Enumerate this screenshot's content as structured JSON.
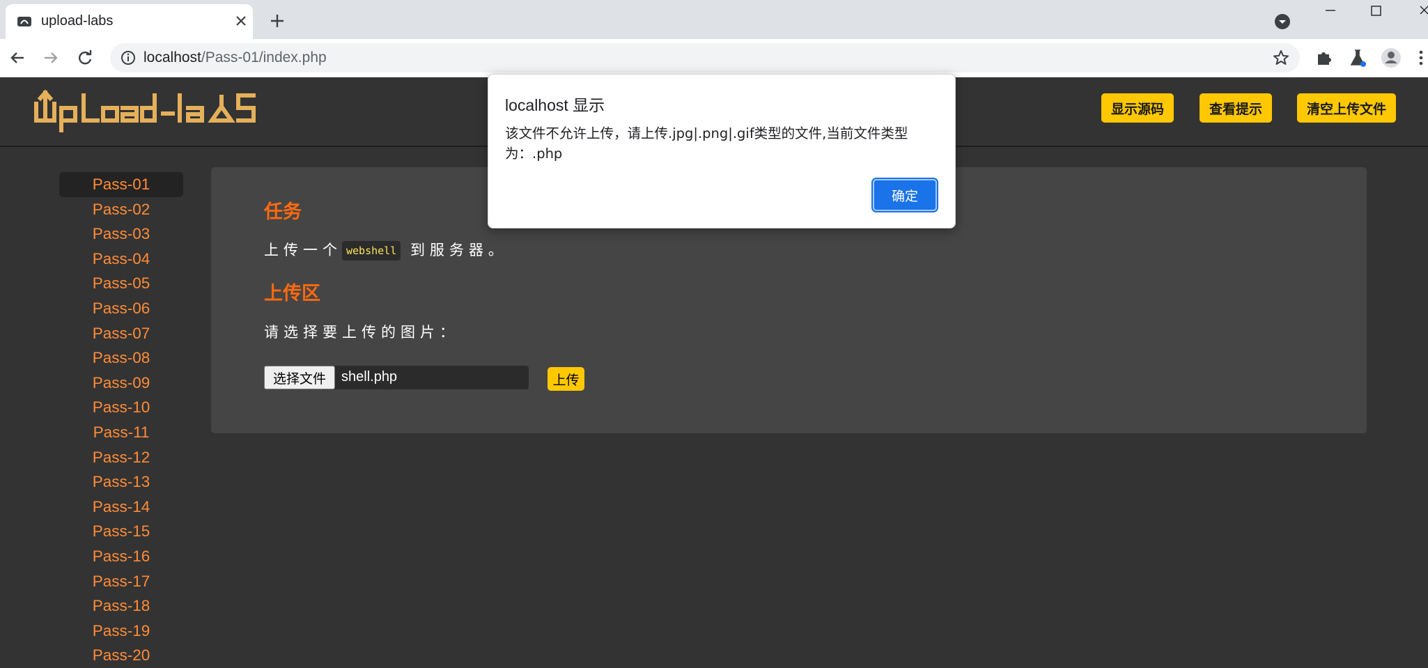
{
  "browser": {
    "tab_title": "upload-labs",
    "url_host": "localhost",
    "url_path": "/Pass-01/index.php"
  },
  "header": {
    "logo_text": "UpLoad-labs",
    "buttons": [
      "显示源码",
      "查看提示",
      "清空上传文件"
    ]
  },
  "sidebar": {
    "items": [
      "Pass-01",
      "Pass-02",
      "Pass-03",
      "Pass-04",
      "Pass-05",
      "Pass-06",
      "Pass-07",
      "Pass-08",
      "Pass-09",
      "Pass-10",
      "Pass-11",
      "Pass-12",
      "Pass-13",
      "Pass-14",
      "Pass-15",
      "Pass-16",
      "Pass-17",
      "Pass-18",
      "Pass-19",
      "Pass-20"
    ],
    "active": "Pass-01"
  },
  "main": {
    "task_title": "任务",
    "task_prefix": "上传一个",
    "task_code": "webshell",
    "task_suffix": "到服务器。",
    "upload_title": "上传区",
    "upload_prompt": "请选择要上传的图片：",
    "choose_file_label": "选择文件",
    "file_name": "shell.php",
    "upload_button": "上传"
  },
  "dialog": {
    "title": "localhost 显示",
    "message": "该文件不允许上传，请上传.jpg|.png|.gif类型的文件,当前文件类型为：.php",
    "ok_label": "确定"
  },
  "colors": {
    "accent_yellow": "#ffc800",
    "link_orange": "#ff8c38",
    "title_orange": "#ff6a0e",
    "page_bg": "#333333",
    "panel_bg": "#454545",
    "dialog_button": "#1a73e8"
  }
}
